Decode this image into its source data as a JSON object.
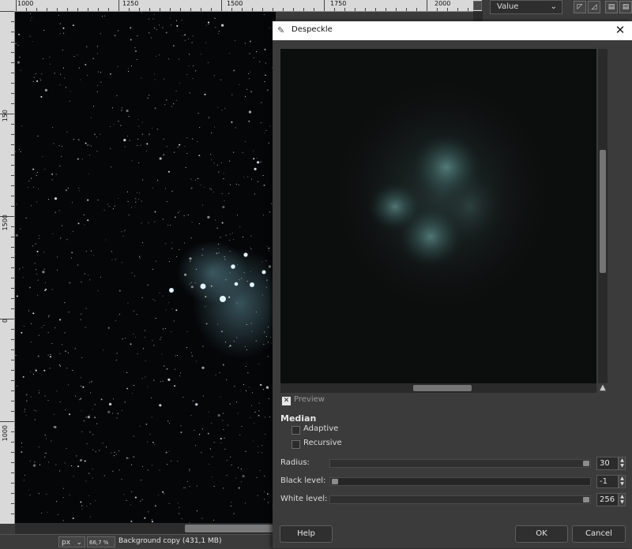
{
  "rulers": {
    "top_labels": [
      "1000",
      "1250",
      "1500",
      "1750",
      "2000"
    ],
    "left_labels": [
      "150",
      "1500",
      "0",
      "1000"
    ]
  },
  "status": {
    "unit": "px",
    "zoom": "66,7 %",
    "layer_info": "Background copy (431,1 MB)"
  },
  "dock": {
    "channel_value": "Value",
    "icons": [
      "linear-histogram-icon",
      "log-histogram-icon",
      "panel-icon",
      "panel-icon"
    ]
  },
  "dialog": {
    "title": "Despeckle",
    "close_glyph": "✕",
    "preview": {
      "label": "Preview",
      "checked": true
    },
    "section_title": "Median",
    "options": {
      "adaptive": {
        "label": "Adaptive",
        "checked": false
      },
      "recursive": {
        "label": "Recursive",
        "checked": false
      }
    },
    "sliders": {
      "radius": {
        "label": "Radius:",
        "value": "30",
        "min": 1,
        "max": 30
      },
      "black": {
        "label": "Black level:",
        "value": "-1",
        "min": -1,
        "max": 255
      },
      "white": {
        "label": "White level:",
        "value": "256",
        "min": 0,
        "max": 256
      }
    },
    "buttons": {
      "help": "Help",
      "ok": "OK",
      "cancel": "Cancel"
    }
  },
  "colors": {
    "dialog_bg": "#3b3b3b",
    "nebula": "#8fd0c6"
  }
}
